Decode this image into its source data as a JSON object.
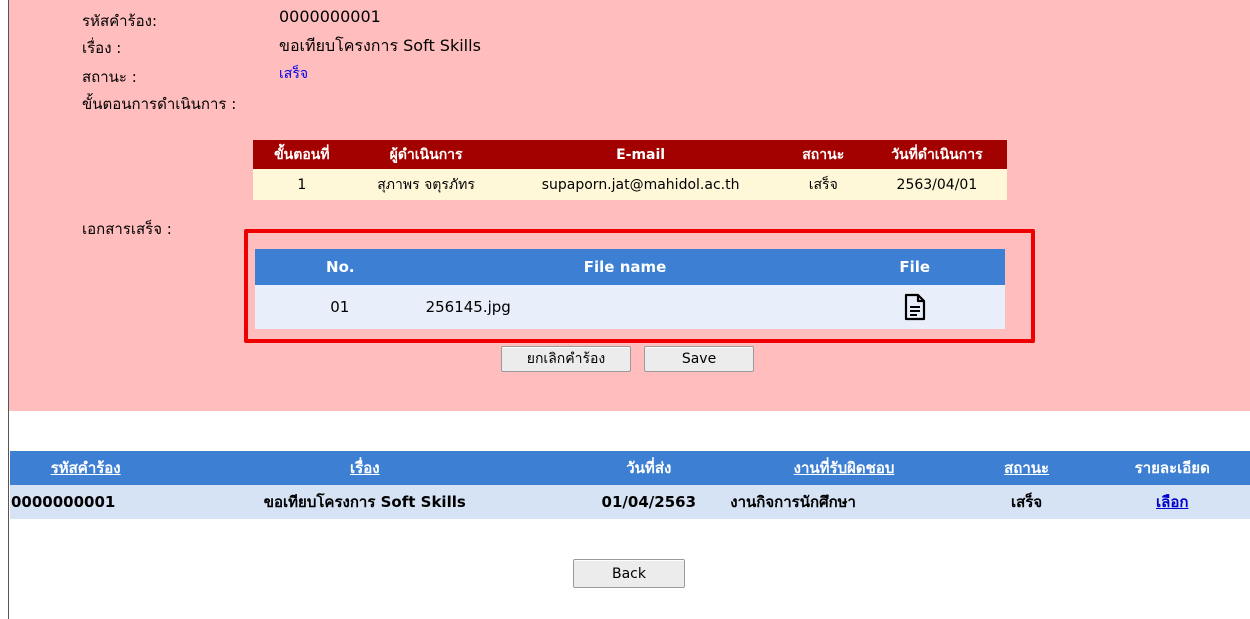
{
  "request": {
    "code_label": "รหัสคำร้อง:",
    "code_value": "0000000001",
    "subject_label": "เรื่อง :",
    "subject_value": "ขอเทียบโครงการ Soft Skills",
    "status_label": "สถานะ :",
    "status_value": "เสร็จ",
    "steps_label": "ขั้นตอนการดำเนินการ :",
    "docs_label": "เอกสารเสร็จ :"
  },
  "steps_table": {
    "headers": [
      "ขั้นตอนที่",
      "ผู้ดำเนินการ",
      "E-mail",
      "สถานะ",
      "วันที่ดำเนินการ"
    ],
    "rows": [
      [
        "1",
        "สุภาพร จตุรภัทร",
        "supaporn.jat@mahidol.ac.th",
        "เสร็จ",
        "2563/04/01"
      ]
    ]
  },
  "docs_table": {
    "headers": [
      "No.",
      "File name",
      "File"
    ],
    "rows": [
      {
        "no": "01",
        "file_name": "256145.jpg",
        "icon": "document-icon"
      }
    ]
  },
  "buttons": {
    "cancel_request": "ยกเลิกคำร้อง",
    "save": "Save",
    "back": "Back"
  },
  "list_table": {
    "headers": [
      "รหัสคำร้อง",
      "เรื่อง",
      "วันที่ส่ง",
      "งานที่รับผิดชอบ",
      "สถานะ",
      "รายละเอียด"
    ],
    "rows": [
      [
        "0000000001",
        "ขอเทียบโครงการ Soft Skills",
        "01/04/2563",
        "งานกิจการนักศึกษา",
        "เสร็จ",
        "เลือก"
      ]
    ]
  },
  "colors": {
    "panel_bg": "#ffbdbd",
    "steps_header": "#a30000",
    "steps_row": "#fff8d8",
    "table_header": "#3d7fd3",
    "highlight_border": "#ee0000"
  }
}
